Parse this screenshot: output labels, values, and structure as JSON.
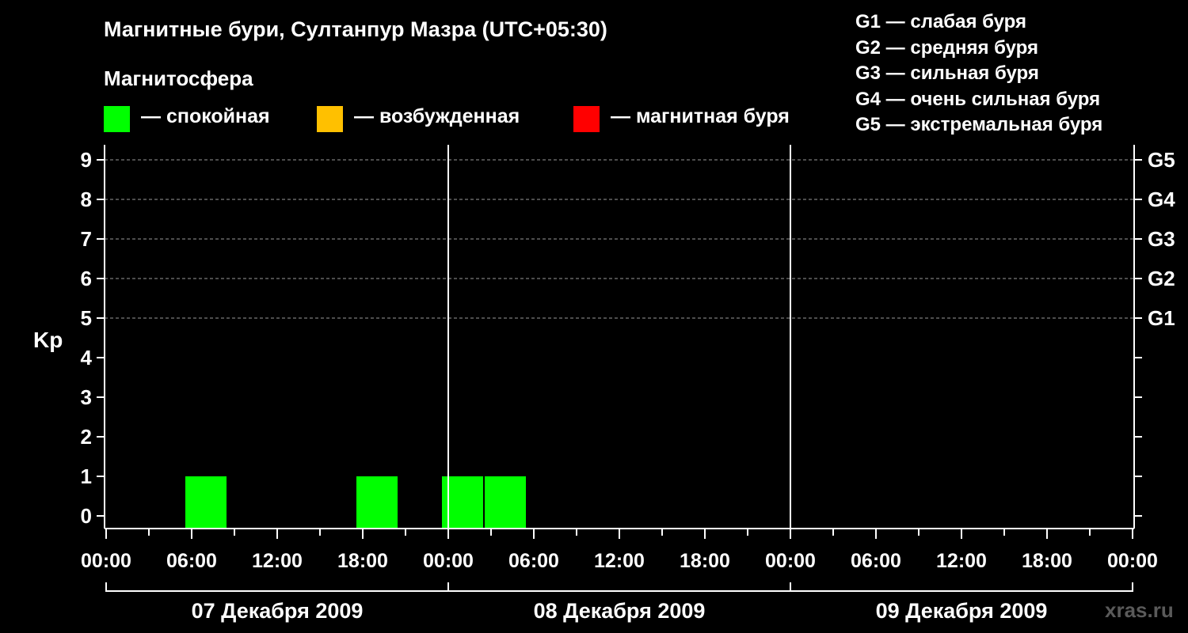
{
  "header": {
    "title": "Магнитные бури, Султанпур Мазра (UTC+05:30)",
    "subtitle": "Магнитосфера"
  },
  "legend": {
    "items": [
      {
        "label": "— спокойная",
        "color": "#00ff00"
      },
      {
        "label": "— возбужденная",
        "color": "#ffc000"
      },
      {
        "label": "— магнитная буря",
        "color": "#ff0000"
      }
    ]
  },
  "storm_scale": [
    "G1 — слабая буря",
    "G2 — средняя буря",
    "G3 — сильная буря",
    "G4 — очень сильная буря",
    "G5 — экстремальная буря"
  ],
  "watermark": "xras.ru",
  "chart_data": {
    "type": "bar",
    "ylabel": "Kp",
    "ylim": [
      0,
      9
    ],
    "y_ticks": [
      "0",
      "1",
      "2",
      "3",
      "4",
      "5",
      "6",
      "7",
      "8",
      "9"
    ],
    "right_axis_labels": [
      {
        "kp": 5,
        "label": "G1"
      },
      {
        "kp": 6,
        "label": "G2"
      },
      {
        "kp": 7,
        "label": "G3"
      },
      {
        "kp": 8,
        "label": "G4"
      },
      {
        "kp": 9,
        "label": "G5"
      }
    ],
    "x_tick_labels": [
      "00:00",
      "06:00",
      "12:00",
      "18:00",
      "00:00",
      "06:00",
      "12:00",
      "18:00",
      "00:00",
      "06:00",
      "12:00",
      "18:00",
      "00:00"
    ],
    "days": [
      "07 Декабря 2009",
      "08 Декабря 2009",
      "09 Декабря 2009"
    ],
    "bar_interval_hours": 3,
    "grid": "dashed horizontal lines at Kp 5–9",
    "bars": [
      {
        "day": "07 Декабря 2009",
        "start": "05:30",
        "end": "08:30",
        "kp": 1,
        "level": "спокойная"
      },
      {
        "day": "07 Декабря 2009",
        "start": "17:30",
        "end": "20:30",
        "kp": 1,
        "level": "спокойная"
      },
      {
        "day": "07 Декабря 2009",
        "start": "23:30",
        "end": "02:30",
        "kp": 1,
        "level": "спокойная"
      },
      {
        "day": "08 Декабря 2009",
        "start": "02:30",
        "end": "05:30",
        "kp": 1,
        "level": "спокойная"
      }
    ],
    "colors": {
      "calm": "#00ff00",
      "excited": "#ffc000",
      "storm": "#ff0000"
    }
  }
}
